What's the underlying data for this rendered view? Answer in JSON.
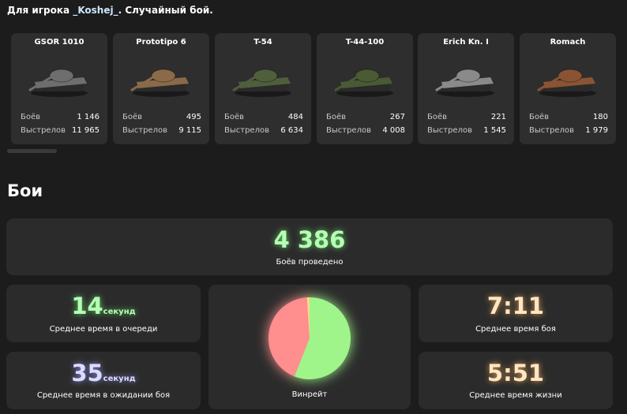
{
  "header": {
    "prefix": "Для игрока",
    "player": "_Koshej_",
    "suffix": ". Случайный бой."
  },
  "tanks": [
    {
      "name": "GSOR 1010",
      "battles_label": "Боёв",
      "battles": "1 146",
      "shots_label": "Выстрелов",
      "shots": "11 965",
      "icon": "tank-icon",
      "color": "#6e6e6e"
    },
    {
      "name": "Prototipo 6",
      "battles_label": "Боёв",
      "battles": "495",
      "shots_label": "Выстрелов",
      "shots": "9 115",
      "icon": "tank-icon",
      "color": "#8a6a48"
    },
    {
      "name": "T-54",
      "battles_label": "Боёв",
      "battles": "484",
      "shots_label": "Выстрелов",
      "shots": "6 634",
      "icon": "tank-icon",
      "color": "#4f5f3c"
    },
    {
      "name": "T-44-100",
      "battles_label": "Боёв",
      "battles": "267",
      "shots_label": "Выстрелов",
      "shots": "4 008",
      "icon": "tank-icon",
      "color": "#4a5a34"
    },
    {
      "name": "Erich Kn. I",
      "battles_label": "Боёв",
      "battles": "221",
      "shots_label": "Выстрелов",
      "shots": "1 545",
      "icon": "tank-icon",
      "color": "#8a8a8a"
    },
    {
      "name": "Romach",
      "battles_label": "Боёв",
      "battles": "180",
      "shots_label": "Выстрелов",
      "shots": "1 979",
      "icon": "tank-icon",
      "color": "#8a5434"
    }
  ],
  "section_title": "Бои",
  "total": {
    "value": "4 386",
    "label": "Боёв проведено",
    "color": "#b4ffb4"
  },
  "queue": {
    "value": "14",
    "unit": "секунд",
    "label": "Среднее время в очереди",
    "color": "#b4ffb4"
  },
  "wait": {
    "value": "35",
    "unit": "секунд",
    "label": "Среднее время в ожидании боя",
    "color": "#dcdcff"
  },
  "winrate": {
    "label": "Винрейт",
    "win_fraction": 0.56,
    "draw_fraction": 0.01,
    "win_color": "#9ff58a",
    "loss_color": "#ff8e8e",
    "draw_color": "#ffd88a"
  },
  "battle_time": {
    "value": "7:11",
    "label": "Среднее время боя",
    "color": "#ffe6c4"
  },
  "life_time": {
    "value": "5:51",
    "label": "Среднее время жизни",
    "color": "#ffe6c4"
  }
}
